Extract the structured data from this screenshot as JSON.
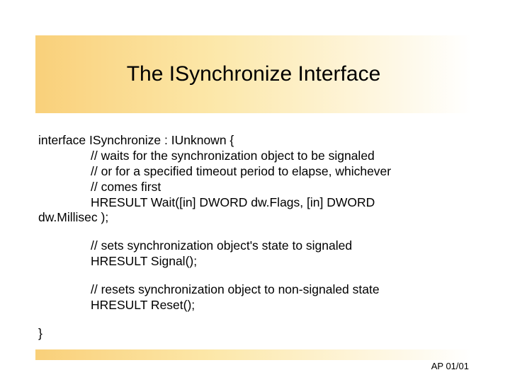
{
  "title": "The ISynchronize Interface",
  "code": {
    "line_open": "interface ISynchronize : IUnknown {",
    "wait_c1": "// waits for the synchronization object to be signaled",
    "wait_c2": "// or for a specified timeout period to elapse, whichever",
    "wait_c3": "// comes first",
    "wait_sig": "HRESULT Wait([in] DWORD dw.Flags, [in] DWORD",
    "wait_sig2": "dw.Millisec );",
    "signal_c1": "// sets synchronization object's state to signaled",
    "signal_sig": "HRESULT Signal();",
    "reset_c1": "// resets synchronization object to non-signaled state",
    "reset_sig": "HRESULT Reset();",
    "line_close": "}"
  },
  "footer": "AP 01/01"
}
